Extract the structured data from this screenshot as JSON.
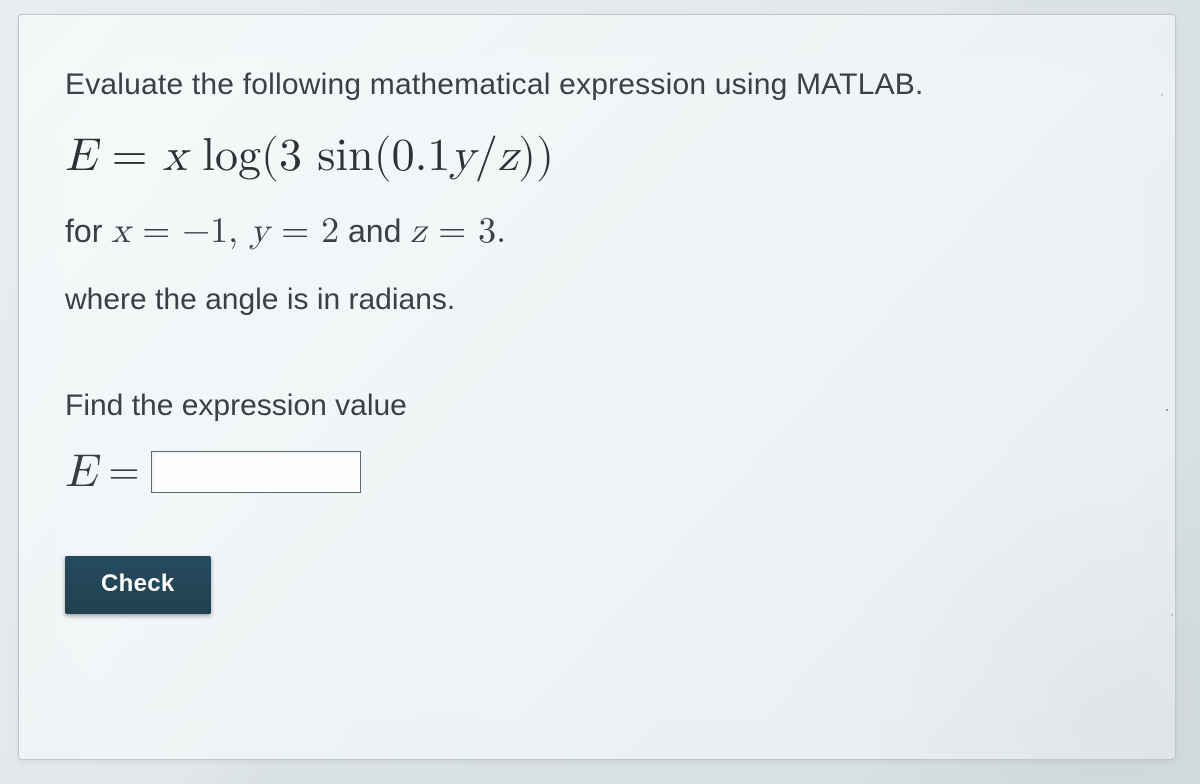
{
  "question": {
    "prompt": "Evaluate the following mathematical expression using MATLAB.",
    "equation": {
      "E": "E",
      "eq": " = ",
      "x": "x",
      "log": " log",
      "open": "(",
      "three": "3 ",
      "sin": "sin",
      "open2": "(",
      "arg": "0.1",
      "y": "y",
      "slash": "/",
      "z": "z",
      "close2": ")",
      "close": ")"
    },
    "values_prefix": "for ",
    "x_eq": "x",
    "x_val": " = −1, ",
    "y_eq": "y",
    "y_val": " = 2",
    "and": " and ",
    "z_eq": "z",
    "z_val": " = 3.",
    "radians_note": "where the angle is in radians.",
    "find_text": "Find the expression value",
    "answer_label_E": "E",
    "answer_label_eq": "=",
    "answer_value": ""
  },
  "buttons": {
    "check": "Check"
  }
}
